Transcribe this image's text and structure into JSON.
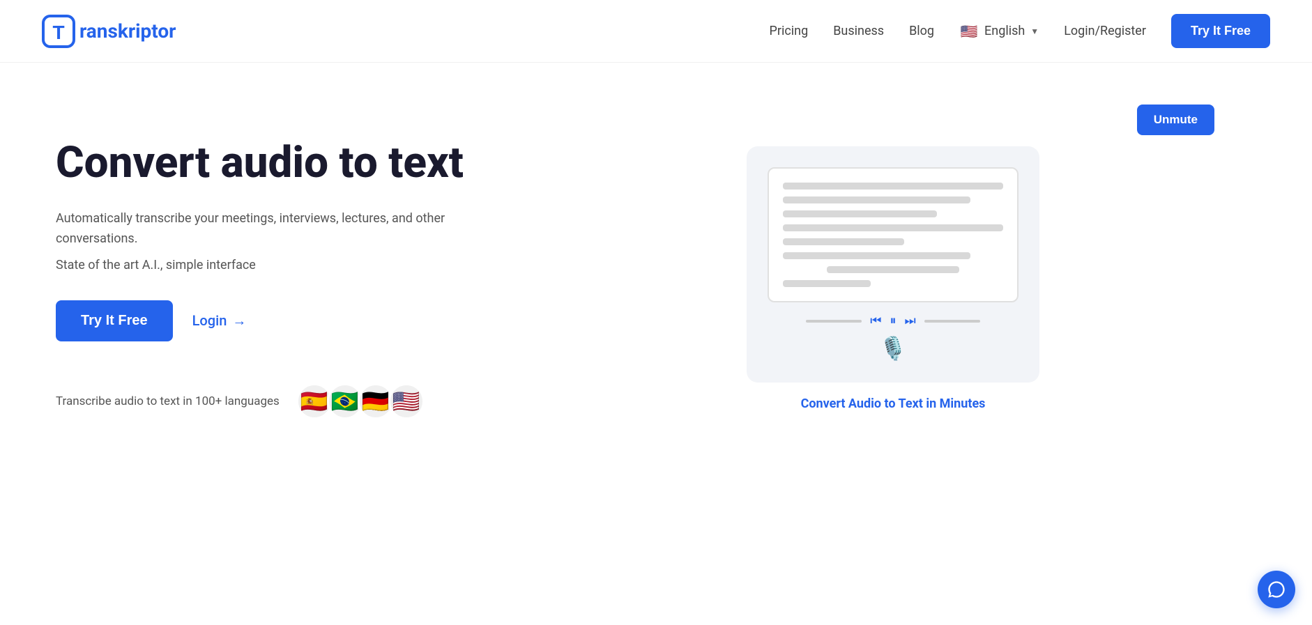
{
  "navbar": {
    "logo_text": "ranskriptor",
    "logo_letter": "T",
    "nav_items": [
      {
        "label": "Pricing",
        "id": "pricing"
      },
      {
        "label": "Business",
        "id": "business"
      },
      {
        "label": "Blog",
        "id": "blog"
      }
    ],
    "language": {
      "label": "English",
      "flag": "🇺🇸"
    },
    "login_label": "Login/Register",
    "try_free_label": "Try It Free"
  },
  "hero": {
    "title": "Convert audio to text",
    "subtitle": "Automatically transcribe your meetings, interviews, lectures, and other conversations.",
    "sub2": "State of the art A.I., simple interface",
    "cta_primary": "Try It Free",
    "cta_secondary": "Login",
    "cta_arrow": "→",
    "languages_text": "Transcribe audio to text in 100+ languages",
    "flags": [
      "🇪🇸",
      "🇧🇷",
      "🇩🇪",
      "🇺🇸"
    ],
    "unmute_label": "Unmute",
    "convert_text": "Convert Audio to Text in Minutes"
  },
  "mock_lines": [
    {
      "width": "full"
    },
    {
      "width": "long"
    },
    {
      "width": "medium"
    },
    {
      "width": "short"
    },
    {
      "width": "full"
    },
    {
      "width": "center"
    },
    {
      "width": "long"
    },
    {
      "width": "xshort"
    }
  ]
}
